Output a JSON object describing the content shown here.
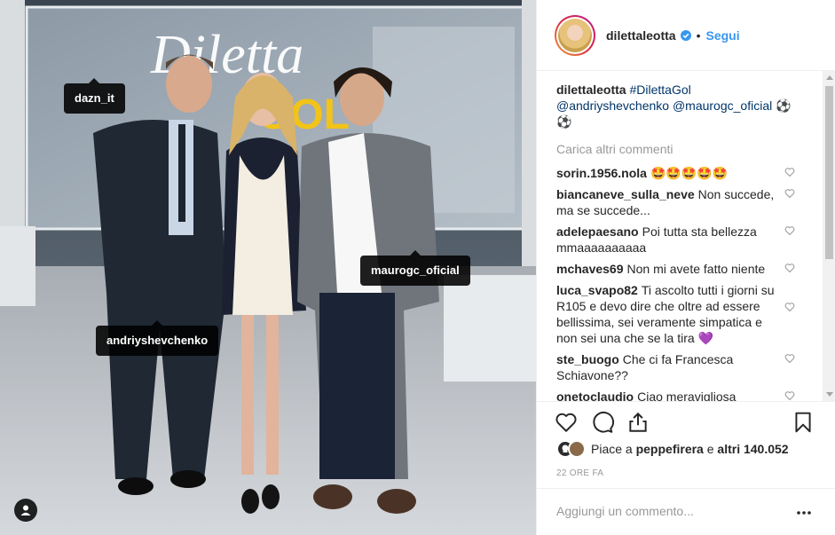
{
  "photo": {
    "tags": [
      {
        "label": "dazn_it"
      },
      {
        "label": "andriyshevchenko"
      },
      {
        "label": "maurogc_oficial"
      }
    ],
    "studio_sign": "Diletta GOL"
  },
  "header": {
    "username": "dilettaleotta",
    "separator": "•",
    "follow_label": "Segui"
  },
  "caption": {
    "username": "dilettaleotta",
    "hashtag": "#DilettaGol",
    "mentions": "@andriyshevchenko @maurogc_oficial",
    "emoji": "⚽ ⚽"
  },
  "load_more_label": "Carica altri commenti",
  "comments": [
    {
      "user": "sorin.1956.nola",
      "text": "🤩🤩🤩🤩🤩"
    },
    {
      "user": "biancaneve_sulla_neve",
      "text": "Non succede, ma se succede..."
    },
    {
      "user": "adelepaesano",
      "text": "Poi tutta sta bellezza mmaaaaaaaaaa"
    },
    {
      "user": "mchaves69",
      "text": "Non mi avete fatto niente"
    },
    {
      "user": "luca_svapo82",
      "text": "Ti ascolto tutti i giorni su R105 e devo dire che oltre ad essere bellissima, sei veramente simpatica e non sei una che se la tira 💜"
    },
    {
      "user": "ste_buogo",
      "text": "Che ci fa Francesca Schiavone??"
    },
    {
      "user": "onetoclaudio",
      "text": "Ciao meravigliosa"
    }
  ],
  "likes": {
    "prefix": "Piace a ",
    "first_user": "peppefirera",
    "middle": " e ",
    "others": "altri 140.052"
  },
  "timestamp": "22 ORE FA",
  "add_comment_placeholder": "Aggiungi un commento...",
  "colors": {
    "accent": "#3897f0",
    "text": "#262626",
    "muted": "#999999",
    "link": "#003569",
    "tag_bg": "#000000"
  },
  "icons": [
    "verified-icon",
    "heart-icon",
    "comment-icon",
    "share-icon",
    "bookmark-icon",
    "more-icon",
    "user-tags-icon"
  ]
}
